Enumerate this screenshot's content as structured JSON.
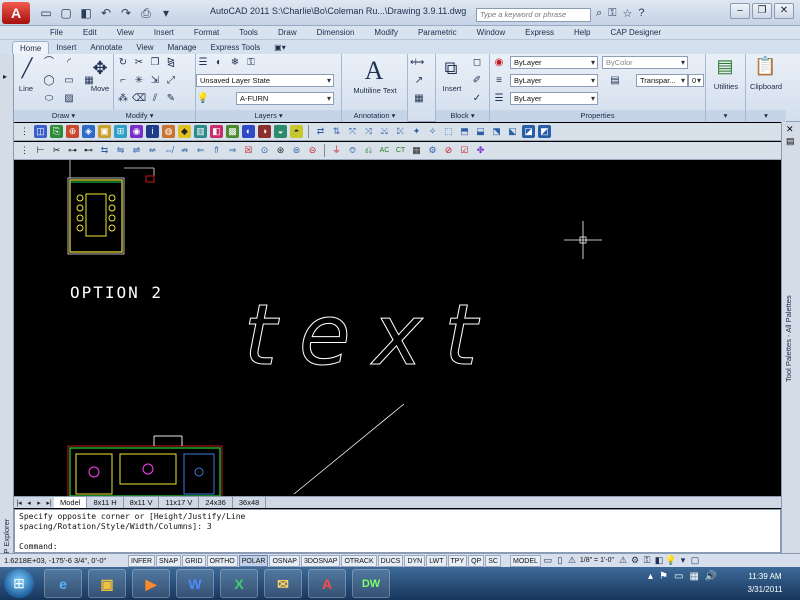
{
  "app": {
    "logo": "A",
    "title": "AutoCAD 2011    S:\\Charlie\\Bo\\Coleman Ru...\\Drawing 3.9.11.dwg",
    "search_placeholder": "Type a keyword or phrase",
    "window_controls": [
      "–",
      "❐",
      "✕"
    ],
    "title_icons": [
      "⌕",
      "⚿",
      "☆",
      "?"
    ]
  },
  "quick_access": [
    "▭",
    "▢",
    "◧",
    "↶",
    "↷",
    "⎙",
    "▾"
  ],
  "menu": [
    "File",
    "Edit",
    "View",
    "Insert",
    "Format",
    "Tools",
    "Draw",
    "Dimension",
    "Modify",
    "Parametric",
    "Window",
    "Express",
    "Help",
    "CAP Designer"
  ],
  "ribbon_tabs": [
    "Home",
    "Insert",
    "Annotate",
    "View",
    "Manage",
    "Express Tools",
    "▣▾"
  ],
  "ribbon": {
    "draw": {
      "label": "Draw ▾",
      "line": "Line",
      "line_icon": "╱"
    },
    "modify": {
      "label": "Modify ▾",
      "move": "Move",
      "move_icon": "✥"
    },
    "layers": {
      "label": "Layers ▾",
      "layer_state": "Unsaved Layer State",
      "current_layer": "A-FURN"
    },
    "annotation": {
      "label": "Annotation ▾",
      "mtext": "Multiline Text",
      "mtext_icon": "A"
    },
    "block": {
      "label": "Block ▾",
      "insert": "Insert"
    },
    "properties": {
      "label": "Properties",
      "color": "ByLayer",
      "linetype": "ByLayer",
      "lineweight": "ByLayer",
      "plot_style": "ByColor",
      "transparency_label": "Transpar...",
      "transparency_value": "0"
    },
    "utilities": {
      "label": "Utilities"
    },
    "clipboard": {
      "label": "Clipboard"
    }
  },
  "canvas": {
    "option_label": "OPTION 2",
    "big_text": "text"
  },
  "layout_tabs": [
    "Model",
    "8x11 H",
    "8x11 V",
    "11x17 V",
    "24x36",
    "36x48"
  ],
  "command": {
    "history_1": "Specify opposite corner or [Height/Justify/Line",
    "history_2": "spacing/Rotation/Style/Width/Columns]: 3",
    "prompt": "Command:"
  },
  "side_panels": {
    "tool_palettes": "Tool Palettes - All Palettes",
    "cap_explorer": "CAP Explorer"
  },
  "status": {
    "coordinates": "1.6218E+03,  -175'-6 3/4\", 0'-0\"",
    "toggles": [
      "INFER",
      "SNAP",
      "GRID",
      "ORTHO",
      "POLAR",
      "OSNAP",
      "3DOSNAP",
      "OTRACK",
      "DUCS",
      "DYN",
      "LWT",
      "TPY",
      "QP",
      "SC"
    ],
    "active_toggle": "POLAR",
    "model_label": "MODEL",
    "scale": "1/8\" = 1'-0\""
  },
  "taskbar": {
    "start_icon": "⊞",
    "apps": [
      "e",
      "▣",
      "▶",
      "W",
      "X",
      "✉",
      "A",
      "DW"
    ],
    "clock_time": "11:39 AM",
    "clock_date": "3/31/2011"
  },
  "colors": {
    "canvas_bg": "#000000",
    "drawing_lines": "#ffffff",
    "plan_yellow": "#f2e53a",
    "plan_green": "#22d43a",
    "accent_red": "#c4161c"
  }
}
